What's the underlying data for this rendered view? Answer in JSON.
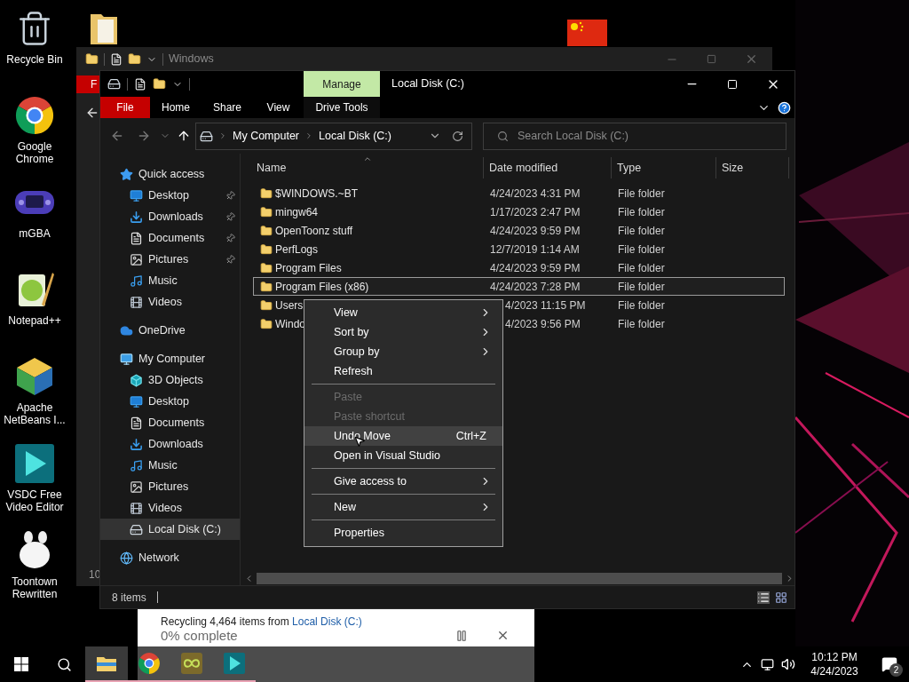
{
  "desktop": {
    "icons": [
      {
        "label": "Recycle Bin",
        "kind": "bin"
      },
      {
        "label": "Google Chrome",
        "kind": "chrome"
      },
      {
        "label": "mGBA",
        "kind": "gba"
      },
      {
        "label": "Notepad++",
        "kind": "notepad"
      },
      {
        "label": "Apache NetBeans I...",
        "kind": "netbeans"
      },
      {
        "label": "VSDC Free Video Editor",
        "kind": "vsdc"
      },
      {
        "label": "Toontown Rewritten",
        "kind": "toontown"
      }
    ]
  },
  "back_window": {
    "title": "Windows",
    "ribbon_tab": "F",
    "status": "10"
  },
  "explorer": {
    "title": "Local Disk (C:)",
    "context_group": "Manage",
    "tabs": [
      {
        "label": "File",
        "kind": "file"
      },
      {
        "label": "Home",
        "kind": "tab"
      },
      {
        "label": "Share",
        "kind": "tab"
      },
      {
        "label": "View",
        "kind": "tab"
      },
      {
        "label": "Drive Tools",
        "kind": "context"
      }
    ],
    "breadcrumb": [
      "My Computer",
      "Local Disk (C:)"
    ],
    "search": {
      "placeholder": "Search Local Disk (C:)"
    },
    "nav": [
      {
        "label": "Quick access",
        "kind": "star",
        "selected": false,
        "children": [
          {
            "label": "Desktop",
            "kind": "desktop",
            "pinned": true,
            "selected": false
          },
          {
            "label": "Downloads",
            "kind": "downloads",
            "pinned": true,
            "selected": false
          },
          {
            "label": "Documents",
            "kind": "documents",
            "pinned": true,
            "selected": false
          },
          {
            "label": "Pictures",
            "kind": "pictures",
            "pinned": true,
            "selected": false
          },
          {
            "label": "Music",
            "kind": "music",
            "pinned": false,
            "selected": false
          },
          {
            "label": "Videos",
            "kind": "videos",
            "pinned": false,
            "selected": false
          }
        ]
      },
      {
        "label": "OneDrive",
        "kind": "cloud",
        "selected": false
      },
      {
        "label": "My Computer",
        "kind": "computer",
        "selected": false,
        "children": [
          {
            "label": "3D Objects",
            "kind": "objects",
            "pinned": false,
            "selected": false
          },
          {
            "label": "Desktop",
            "kind": "desktop",
            "pinned": false,
            "selected": false
          },
          {
            "label": "Documents",
            "kind": "documents",
            "pinned": false,
            "selected": false
          },
          {
            "label": "Downloads",
            "kind": "downloads",
            "pinned": false,
            "selected": false
          },
          {
            "label": "Music",
            "kind": "music",
            "pinned": false,
            "selected": false
          },
          {
            "label": "Pictures",
            "kind": "pictures",
            "pinned": false,
            "selected": false
          },
          {
            "label": "Videos",
            "kind": "videos",
            "pinned": false,
            "selected": false
          },
          {
            "label": "Local Disk (C:)",
            "kind": "drive",
            "pinned": false,
            "selected": true
          }
        ]
      },
      {
        "label": "Network",
        "kind": "network",
        "selected": false
      }
    ],
    "columns": [
      "Name",
      "Date modified",
      "Type",
      "Size"
    ],
    "rows": [
      {
        "name": "$WINDOWS.~BT",
        "date": "4/24/2023 4:31 PM",
        "type": "File folder",
        "selected": false,
        "covered": false
      },
      {
        "name": "mingw64",
        "date": "1/17/2023 2:47 PM",
        "type": "File folder",
        "selected": false,
        "covered": false
      },
      {
        "name": "OpenToonz stuff",
        "date": "4/24/2023 9:59 PM",
        "type": "File folder",
        "selected": false,
        "covered": false
      },
      {
        "name": "PerfLogs",
        "date": "12/7/2019 1:14 AM",
        "type": "File folder",
        "selected": false,
        "covered": false
      },
      {
        "name": "Program Files",
        "date": "4/24/2023 9:59 PM",
        "type": "File folder",
        "selected": false,
        "covered": false
      },
      {
        "name": "Program Files (x86)",
        "date": "4/24/2023 7:28 PM",
        "type": "File folder",
        "selected": true,
        "covered": false
      },
      {
        "name": "Users",
        "date": "4/2023 11:15 PM",
        "type": "File folder",
        "selected": false,
        "covered": true
      },
      {
        "name": "Windo",
        "date": "4/2023 9:56 PM",
        "type": "File folder",
        "selected": false,
        "covered": true
      }
    ],
    "status": "8 items"
  },
  "context_menu": {
    "items": [
      {
        "kind": "submenu",
        "label": "View",
        "disabled": false,
        "selected": false
      },
      {
        "kind": "submenu",
        "label": "Sort by",
        "disabled": false,
        "selected": false
      },
      {
        "kind": "submenu",
        "label": "Group by",
        "disabled": false,
        "selected": false
      },
      {
        "kind": "item",
        "label": "Refresh",
        "disabled": false,
        "selected": false
      },
      {
        "kind": "separator"
      },
      {
        "kind": "item",
        "label": "Paste",
        "disabled": true,
        "selected": false
      },
      {
        "kind": "item",
        "label": "Paste shortcut",
        "disabled": true,
        "selected": false
      },
      {
        "kind": "item",
        "label": "Undo Move",
        "shortcut": "Ctrl+Z",
        "disabled": false,
        "selected": true
      },
      {
        "kind": "item",
        "label": "Open in Visual Studio",
        "disabled": false,
        "selected": false
      },
      {
        "kind": "separator"
      },
      {
        "kind": "submenu",
        "label": "Give access to",
        "disabled": false,
        "selected": false
      },
      {
        "kind": "separator"
      },
      {
        "kind": "submenu",
        "label": "New",
        "disabled": false,
        "selected": false
      },
      {
        "kind": "separator"
      },
      {
        "kind": "item",
        "label": "Properties",
        "disabled": false,
        "selected": false
      }
    ]
  },
  "progress_dialog": {
    "text": "Recycling 4,464 items from ",
    "link": "Local Disk (C:)",
    "status": "0% complete"
  },
  "taskbar": {
    "apps": [
      {
        "kind": "explorer",
        "active": true
      },
      {
        "kind": "chrome",
        "active": false
      },
      {
        "kind": "app",
        "active": false
      },
      {
        "kind": "vsdc",
        "active": false
      }
    ],
    "time": "10:12 PM",
    "date": "4/24/2023",
    "notifications": "2"
  }
}
